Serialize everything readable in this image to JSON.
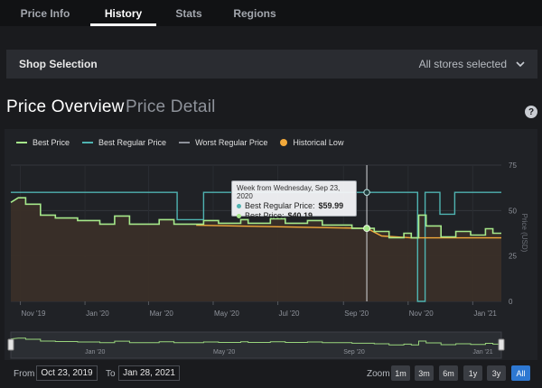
{
  "tabs": [
    {
      "label": "Price Info"
    },
    {
      "label": "History"
    },
    {
      "label": "Stats"
    },
    {
      "label": "Regions"
    }
  ],
  "shop_selection": {
    "label": "Shop Selection",
    "value": "All stores selected",
    "icon": "chevron-down-icon"
  },
  "view_tabs": {
    "overview": "Price Overview",
    "detail": "Price Detail",
    "help_icon": "question-circle-icon",
    "help_glyph": "?"
  },
  "legend": [
    {
      "label": "Best Price",
      "color": "#a6e88a"
    },
    {
      "label": "Best Regular Price",
      "color": "#4fb3b1"
    },
    {
      "label": "Worst Regular Price",
      "color": "#8e929a"
    },
    {
      "label": "Historical Low",
      "color": "#f2a93b"
    }
  ],
  "tooltip": {
    "header": "Week from Wednesday, Sep 23, 2020",
    "regular_label": "Best Regular Price:",
    "regular_value": "$59.99",
    "best_label": "Best Price:",
    "best_value": "$40.19"
  },
  "chart_data": {
    "type": "line",
    "ylabel": "Price (USD)",
    "ylim": [
      0,
      75
    ],
    "yticks": [
      "0",
      "25",
      "50",
      "75"
    ],
    "xticks": [
      "Nov '19",
      "Jan '20",
      "Mar '20",
      "May '20",
      "Jul '20",
      "Sep '20",
      "Nov '20",
      "Jan '21"
    ],
    "grid": true,
    "crosshair_date": "2020-09-23",
    "navigator_ticks": [
      "Jan '20",
      "May '20",
      "Sep '20",
      "Jan '21"
    ],
    "series": [
      {
        "name": "Best Regular Price",
        "color": "#4fb3b1",
        "points": [
          [
            "2019-10-23",
            59.99
          ],
          [
            "2020-03-28",
            59.99
          ],
          [
            "2020-03-28",
            44.99
          ],
          [
            "2020-04-22",
            44.99
          ],
          [
            "2020-04-22",
            59.99
          ],
          [
            "2020-11-10",
            59.99
          ],
          [
            "2020-11-10",
            0
          ],
          [
            "2020-11-17",
            0
          ],
          [
            "2020-11-17",
            59.99
          ],
          [
            "2020-12-01",
            59.99
          ],
          [
            "2020-12-01",
            47.99
          ],
          [
            "2020-12-15",
            47.99
          ],
          [
            "2020-12-15",
            59.99
          ],
          [
            "2021-01-28",
            59.99
          ]
        ]
      },
      {
        "name": "Best Price",
        "color": "#a6e88a",
        "points": [
          [
            "2019-10-23",
            54.5
          ],
          [
            "2019-10-30",
            57
          ],
          [
            "2019-11-06",
            57
          ],
          [
            "2019-11-06",
            53.5
          ],
          [
            "2019-11-20",
            53.5
          ],
          [
            "2019-11-20",
            47.5
          ],
          [
            "2019-12-04",
            47.5
          ],
          [
            "2019-12-04",
            45.9
          ],
          [
            "2019-12-25",
            45.9
          ],
          [
            "2019-12-25",
            44.5
          ],
          [
            "2020-01-15",
            44.5
          ],
          [
            "2020-01-15",
            42.5
          ],
          [
            "2020-01-29",
            42.5
          ],
          [
            "2020-01-29",
            47
          ],
          [
            "2020-02-12",
            47
          ],
          [
            "2020-02-12",
            42.5
          ],
          [
            "2020-03-11",
            42.5
          ],
          [
            "2020-03-11",
            45
          ],
          [
            "2020-03-25",
            45
          ],
          [
            "2020-03-25",
            42.5
          ],
          [
            "2020-04-22",
            42.5
          ],
          [
            "2020-04-22",
            44.5
          ],
          [
            "2020-05-06",
            44.5
          ],
          [
            "2020-05-06",
            43
          ],
          [
            "2020-05-27",
            43
          ],
          [
            "2020-05-27",
            45
          ],
          [
            "2020-06-03",
            45
          ],
          [
            "2020-06-03",
            43
          ],
          [
            "2020-06-24",
            43
          ],
          [
            "2020-06-24",
            45.5
          ],
          [
            "2020-07-08",
            45.5
          ],
          [
            "2020-07-08",
            43
          ],
          [
            "2020-07-29",
            43
          ],
          [
            "2020-07-29",
            44.5
          ],
          [
            "2020-08-12",
            44.5
          ],
          [
            "2020-08-12",
            42
          ],
          [
            "2020-09-09",
            42
          ],
          [
            "2020-09-09",
            40.19
          ],
          [
            "2020-09-30",
            40.19
          ],
          [
            "2020-09-30",
            38.5
          ],
          [
            "2020-10-14",
            38.5
          ],
          [
            "2020-10-14",
            35
          ],
          [
            "2020-10-28",
            35
          ],
          [
            "2020-10-28",
            37.5
          ],
          [
            "2020-11-04",
            37.5
          ],
          [
            "2020-11-04",
            34.99
          ],
          [
            "2020-11-11",
            34.99
          ],
          [
            "2020-11-11",
            47.5
          ],
          [
            "2020-11-18",
            47.5
          ],
          [
            "2020-11-18",
            41.5
          ],
          [
            "2020-12-02",
            41.5
          ],
          [
            "2020-12-02",
            35.5
          ],
          [
            "2020-12-16",
            35.5
          ],
          [
            "2020-12-16",
            38.5
          ],
          [
            "2020-12-30",
            38.5
          ],
          [
            "2020-12-30",
            36.5
          ],
          [
            "2021-01-13",
            36.5
          ],
          [
            "2021-01-13",
            40
          ],
          [
            "2021-01-20",
            40
          ],
          [
            "2021-01-20",
            37.5
          ],
          [
            "2021-01-28",
            37.5
          ]
        ]
      },
      {
        "name": "Historical Low",
        "color": "#f2a93b",
        "points": [
          [
            "2020-04-15",
            41.9
          ],
          [
            "2020-09-23",
            40.19
          ],
          [
            "2020-10-07",
            35.99
          ],
          [
            "2020-11-04",
            34.99
          ],
          [
            "2021-01-28",
            34.99
          ]
        ]
      }
    ]
  },
  "date_range": {
    "from_label": "From",
    "from_value": "Oct 23, 2019",
    "to_label": "To",
    "to_value": "Jan 28, 2021"
  },
  "zoom": {
    "label": "Zoom",
    "buttons": [
      "1m",
      "3m",
      "6m",
      "1y",
      "3y",
      "All"
    ],
    "active": "All",
    "active_color": "#2e78d2"
  }
}
